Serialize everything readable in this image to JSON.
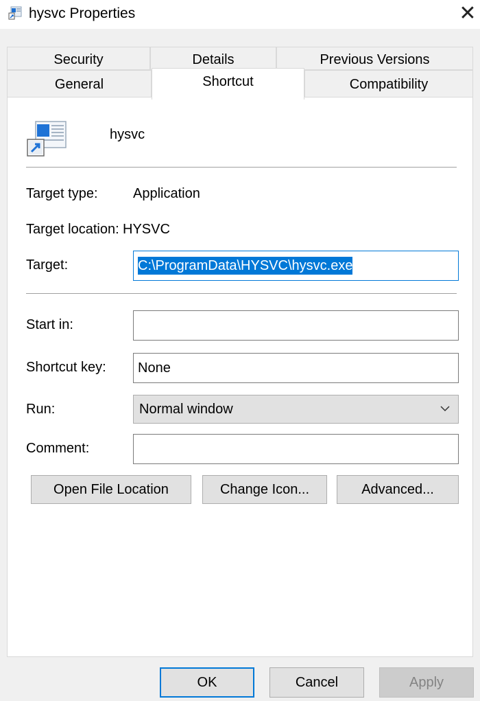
{
  "window": {
    "title": "hysvc Properties",
    "close_glyph": "✕"
  },
  "tabs": {
    "row1": [
      "Security",
      "Details",
      "Previous Versions"
    ],
    "row2": [
      "General",
      "Shortcut",
      "Compatibility"
    ],
    "active": "Shortcut"
  },
  "shortcut": {
    "file_name": "hysvc",
    "target_type_label": "Target type:",
    "target_type_value": "Application",
    "target_location_label": "Target location:",
    "target_location_value": "HYSVC",
    "target_label": "Target:",
    "target_value": "C:\\ProgramData\\HYSVC\\hysvc.exe",
    "start_in_label": "Start in:",
    "start_in_value": "",
    "shortcut_key_label": "Shortcut key:",
    "shortcut_key_value": "None",
    "run_label": "Run:",
    "run_value": "Normal window",
    "comment_label": "Comment:",
    "comment_value": "",
    "open_file_location": "Open File Location",
    "change_icon": "Change Icon...",
    "advanced": "Advanced..."
  },
  "footer": {
    "ok": "OK",
    "cancel": "Cancel",
    "apply": "Apply"
  },
  "colors": {
    "accent": "#0078d7",
    "dialog_bg": "#f0f0f0",
    "button_bg": "#e1e1e1"
  },
  "icons": {
    "app": "shortcut-app-icon",
    "file": "application-shortcut-icon",
    "close": "close-icon",
    "dropdown": "chevron-down-icon"
  }
}
